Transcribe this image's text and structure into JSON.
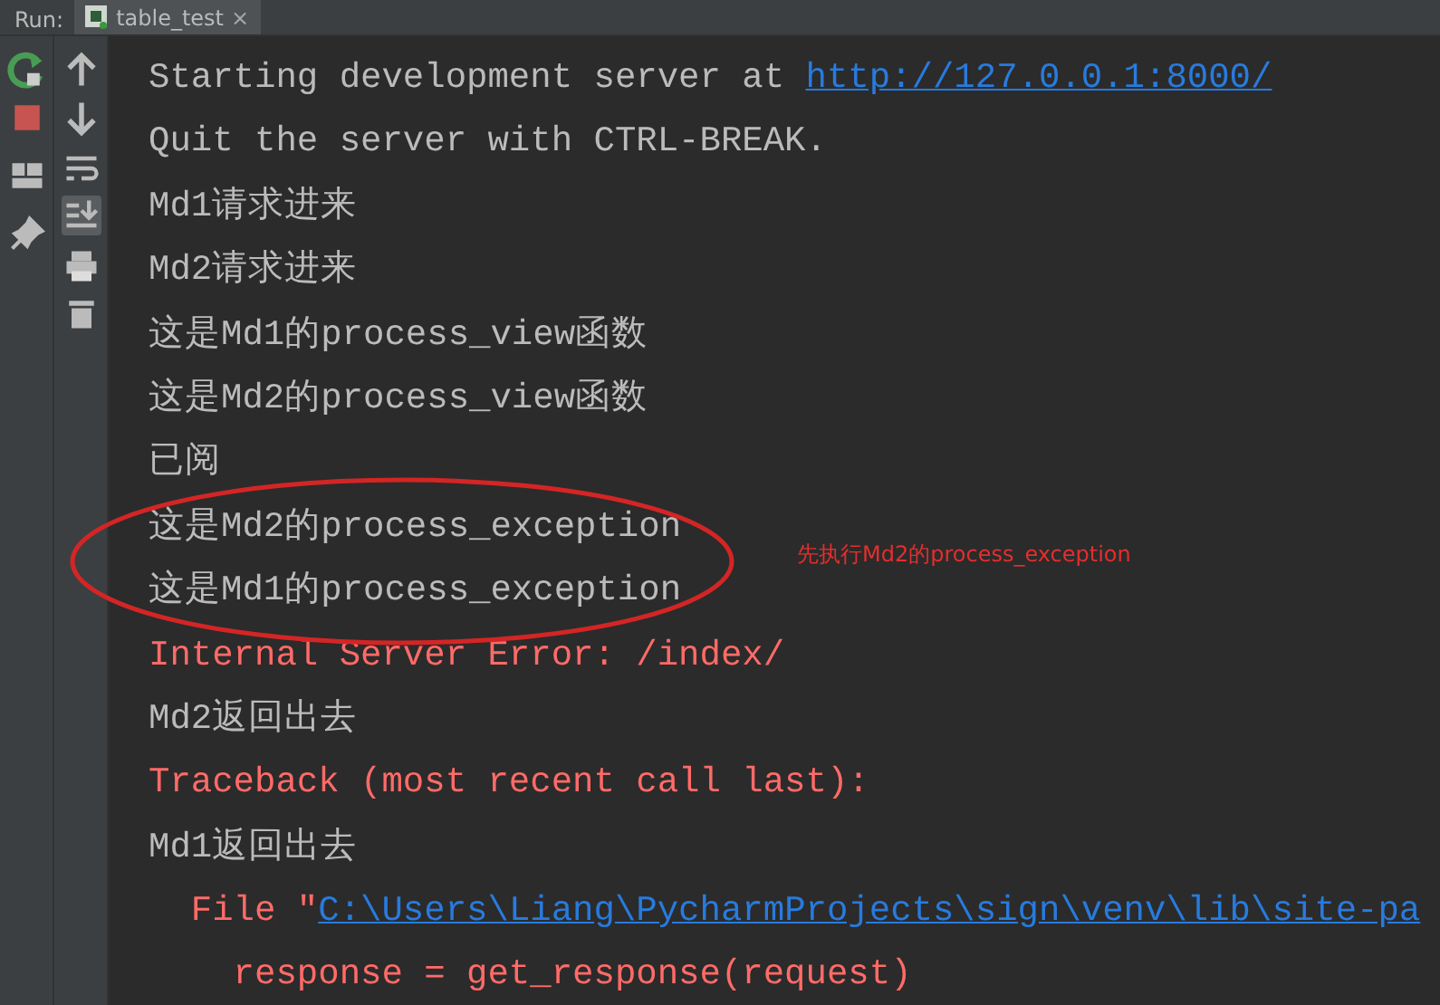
{
  "run_panel": {
    "label": "Run:",
    "tab": {
      "title": "table_test",
      "close": "×",
      "selected": true
    }
  },
  "toolbar": [
    {
      "kind": "up",
      "selected": false
    },
    {
      "kind": "down",
      "selected": false
    },
    {
      "kind": "wrap",
      "selected": false
    },
    {
      "kind": "scroll-end",
      "selected": true
    },
    {
      "kind": "print",
      "selected": false
    },
    {
      "kind": "trash",
      "selected": false
    }
  ],
  "console": [
    {
      "kind": "normal",
      "text": "Starting development server at ",
      "link": "http://127.0.0.1:8000/"
    },
    {
      "kind": "normal",
      "text": "Quit the server with CTRL-BREAK."
    },
    {
      "kind": "normal",
      "text": "Md1请求进来"
    },
    {
      "kind": "normal",
      "text": "Md2请求进来"
    },
    {
      "kind": "normal",
      "text": "这是Md1的process_view函数"
    },
    {
      "kind": "normal",
      "text": "这是Md2的process_view函数"
    },
    {
      "kind": "normal",
      "text": "已阅"
    },
    {
      "kind": "normal",
      "text": "这是Md2的process_exception"
    },
    {
      "kind": "normal",
      "text": "这是Md1的process_exception"
    },
    {
      "kind": "error",
      "text": "Internal Server Error: /index/"
    },
    {
      "kind": "normal",
      "text": "Md2返回出去"
    },
    {
      "kind": "error",
      "text": "Traceback (most recent call last):"
    },
    {
      "kind": "normal",
      "text": "Md1返回出去"
    },
    {
      "kind": "error",
      "text": "  File \"",
      "link": "C:\\Users\\Liang\\PycharmProjects\\sign\\venv\\lib\\site-pa"
    },
    {
      "kind": "error",
      "text": "    response = get_response(request)"
    }
  ],
  "annotation": {
    "text": "先执行Md2的process_exception"
  }
}
